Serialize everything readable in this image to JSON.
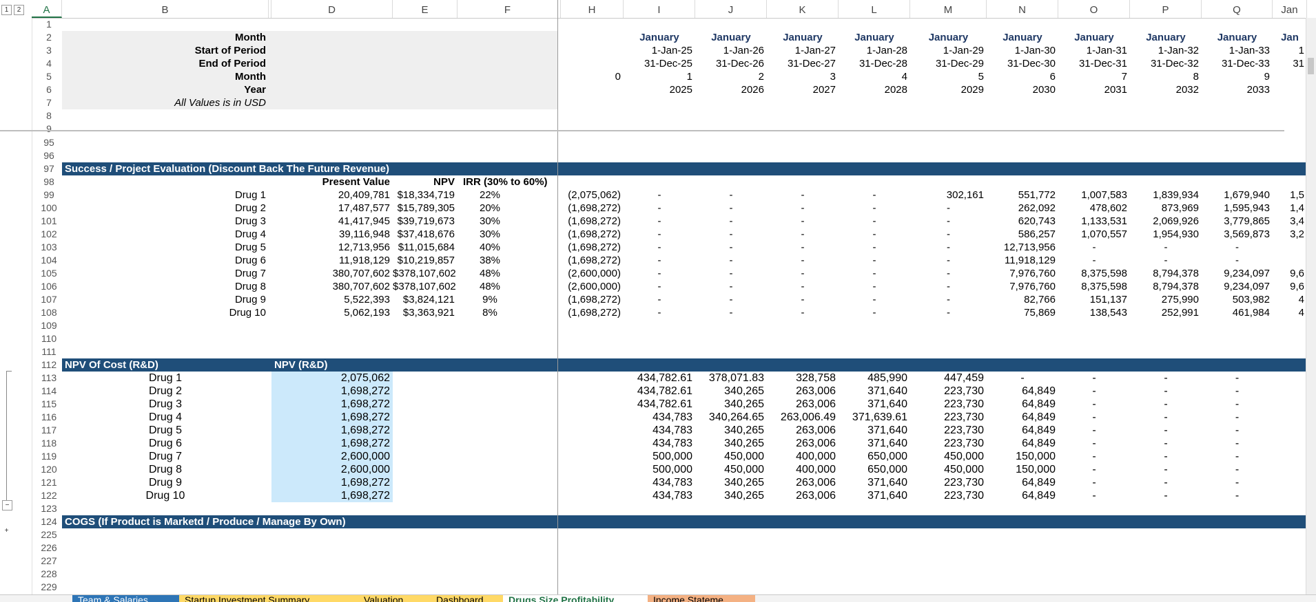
{
  "outline_levels": [
    "1",
    "2"
  ],
  "outline_collapse": "−",
  "outline_expand": "+",
  "columns": [
    "A",
    "B",
    "",
    "D",
    "E",
    "F",
    "",
    "H",
    "I",
    "J",
    "K",
    "L",
    "M",
    "N",
    "O",
    "P",
    "Q",
    "Jan"
  ],
  "header": {
    "labels": [
      "Month",
      "Start of Period",
      "End of Period",
      "Month",
      "Year"
    ],
    "note": "All Values is in USD",
    "h_month_index": "0",
    "months": [
      "January",
      "January",
      "January",
      "January",
      "January",
      "January",
      "January",
      "January",
      "January",
      "Jan"
    ],
    "starts": [
      "1-Jan-25",
      "1-Jan-26",
      "1-Jan-27",
      "1-Jan-28",
      "1-Jan-29",
      "1-Jan-30",
      "1-Jan-31",
      "1-Jan-32",
      "1-Jan-33",
      "1"
    ],
    "ends": [
      "31-Dec-25",
      "31-Dec-26",
      "31-Dec-27",
      "31-Dec-28",
      "31-Dec-29",
      "31-Dec-30",
      "31-Dec-31",
      "31-Dec-32",
      "31-Dec-33",
      "31"
    ],
    "month_nums": [
      "1",
      "2",
      "3",
      "4",
      "5",
      "6",
      "7",
      "8",
      "9"
    ],
    "years": [
      "2025",
      "2026",
      "2027",
      "2028",
      "2029",
      "2030",
      "2031",
      "2032",
      "2033"
    ]
  },
  "row_numbers_top": [
    "1",
    "2",
    "3",
    "4",
    "5",
    "6",
    "7",
    "8",
    "9"
  ],
  "success": {
    "title": "Success / Project Evaluation (Discount Back The Future Revenue)",
    "headers": [
      "Present Value",
      "NPV",
      "IRR (30% to 60%)"
    ],
    "rows": [
      {
        "n": "99",
        "drug": "Drug 1",
        "pv": "20,409,781",
        "npv": "$18,334,719",
        "irr": "22%",
        "h": "(2,075,062)",
        "v": [
          "-",
          "-",
          "-",
          "-",
          "302,161",
          "551,772",
          "1,007,583",
          "1,839,934",
          "1,679,940",
          "1,5"
        ]
      },
      {
        "n": "100",
        "drug": "Drug 2",
        "pv": "17,487,577",
        "npv": "$15,789,305",
        "irr": "20%",
        "h": "(1,698,272)",
        "v": [
          "-",
          "-",
          "-",
          "-",
          "-",
          "262,092",
          "478,602",
          "873,969",
          "1,595,943",
          "1,4"
        ]
      },
      {
        "n": "101",
        "drug": "Drug 3",
        "pv": "41,417,945",
        "npv": "$39,719,673",
        "irr": "30%",
        "h": "(1,698,272)",
        "v": [
          "-",
          "-",
          "-",
          "-",
          "-",
          "620,743",
          "1,133,531",
          "2,069,926",
          "3,779,865",
          "3,4"
        ]
      },
      {
        "n": "102",
        "drug": "Drug 4",
        "pv": "39,116,948",
        "npv": "$37,418,676",
        "irr": "30%",
        "h": "(1,698,272)",
        "v": [
          "-",
          "-",
          "-",
          "-",
          "-",
          "586,257",
          "1,070,557",
          "1,954,930",
          "3,569,873",
          "3,2"
        ]
      },
      {
        "n": "103",
        "drug": "Drug 5",
        "pv": "12,713,956",
        "npv": "$11,015,684",
        "irr": "40%",
        "h": "(1,698,272)",
        "v": [
          "-",
          "-",
          "-",
          "-",
          "-",
          "12,713,956",
          "-",
          "-",
          "-",
          ""
        ]
      },
      {
        "n": "104",
        "drug": "Drug 6",
        "pv": "11,918,129",
        "npv": "$10,219,857",
        "irr": "38%",
        "h": "(1,698,272)",
        "v": [
          "-",
          "-",
          "-",
          "-",
          "-",
          "11,918,129",
          "-",
          "-",
          "-",
          ""
        ]
      },
      {
        "n": "105",
        "drug": "Drug 7",
        "pv": "380,707,602",
        "npv": "$378,107,602",
        "irr": "48%",
        "h": "(2,600,000)",
        "v": [
          "-",
          "-",
          "-",
          "-",
          "-",
          "7,976,760",
          "8,375,598",
          "8,794,378",
          "9,234,097",
          "9,6"
        ]
      },
      {
        "n": "106",
        "drug": "Drug 8",
        "pv": "380,707,602",
        "npv": "$378,107,602",
        "irr": "48%",
        "h": "(2,600,000)",
        "v": [
          "-",
          "-",
          "-",
          "-",
          "-",
          "7,976,760",
          "8,375,598",
          "8,794,378",
          "9,234,097",
          "9,6"
        ]
      },
      {
        "n": "107",
        "drug": "Drug 9",
        "pv": "5,522,393",
        "npv": "$3,824,121",
        "irr": "9%",
        "h": "(1,698,272)",
        "v": [
          "-",
          "-",
          "-",
          "-",
          "-",
          "82,766",
          "151,137",
          "275,990",
          "503,982",
          "4"
        ]
      },
      {
        "n": "108",
        "drug": "Drug 10",
        "pv": "5,062,193",
        "npv": "$3,363,921",
        "irr": "8%",
        "h": "(1,698,272)",
        "v": [
          "-",
          "-",
          "-",
          "-",
          "-",
          "75,869",
          "138,543",
          "252,991",
          "461,984",
          "4"
        ]
      }
    ]
  },
  "npv_cost": {
    "title": "NPV Of Cost (R&D)",
    "col_title": "NPV (R&D)",
    "rows": [
      {
        "n": "113",
        "drug": "Drug 1",
        "npv": "2,075,062",
        "v": [
          "434,782.61",
          "378,071.83",
          "328,758",
          "485,990",
          "447,459",
          "-",
          "-",
          "-",
          "-"
        ]
      },
      {
        "n": "114",
        "drug": "Drug 2",
        "npv": "1,698,272",
        "v": [
          "434,782.61",
          "340,265",
          "263,006",
          "371,640",
          "223,730",
          "64,849",
          "-",
          "-",
          "-"
        ]
      },
      {
        "n": "115",
        "drug": "Drug 3",
        "npv": "1,698,272",
        "v": [
          "434,782.61",
          "340,265",
          "263,006",
          "371,640",
          "223,730",
          "64,849",
          "-",
          "-",
          "-"
        ]
      },
      {
        "n": "116",
        "drug": "Drug 4",
        "npv": "1,698,272",
        "v": [
          "434,783",
          "340,264.65",
          "263,006.49",
          "371,639.61",
          "223,730",
          "64,849",
          "-",
          "-",
          "-"
        ]
      },
      {
        "n": "117",
        "drug": "Drug 5",
        "npv": "1,698,272",
        "v": [
          "434,783",
          "340,265",
          "263,006",
          "371,640",
          "223,730",
          "64,849",
          "-",
          "-",
          "-"
        ]
      },
      {
        "n": "118",
        "drug": "Drug 6",
        "npv": "1,698,272",
        "v": [
          "434,783",
          "340,265",
          "263,006",
          "371,640",
          "223,730",
          "64,849",
          "-",
          "-",
          "-"
        ]
      },
      {
        "n": "119",
        "drug": "Drug 7",
        "npv": "2,600,000",
        "v": [
          "500,000",
          "450,000",
          "400,000",
          "650,000",
          "450,000",
          "150,000",
          "-",
          "-",
          "-"
        ]
      },
      {
        "n": "120",
        "drug": "Drug 8",
        "npv": "2,600,000",
        "v": [
          "500,000",
          "450,000",
          "400,000",
          "650,000",
          "450,000",
          "150,000",
          "-",
          "-",
          "-"
        ]
      },
      {
        "n": "121",
        "drug": "Drug 9",
        "npv": "1,698,272",
        "v": [
          "434,783",
          "340,265",
          "263,006",
          "371,640",
          "223,730",
          "64,849",
          "-",
          "-",
          "-"
        ]
      },
      {
        "n": "122",
        "drug": "Drug 10",
        "npv": "1,698,272",
        "v": [
          "434,783",
          "340,265",
          "263,006",
          "371,640",
          "223,730",
          "64,849",
          "-",
          "-",
          "-"
        ]
      }
    ]
  },
  "cogs_title": "COGS (If Product is Marketd / Produce / Manage By Own)",
  "empty_rows": [
    "95",
    "96",
    "109",
    "110",
    "111",
    "123",
    "225",
    "226",
    "227",
    "228",
    "229"
  ],
  "row_labels": {
    "r97": "97",
    "r98": "98",
    "r112": "112",
    "r124": "124"
  },
  "sheet_tabs": [
    "Team & Salaries",
    "Startup Investment Summary",
    "Valuation",
    "Dashboard",
    "Drugs Size Profitability",
    "Income Stateme"
  ],
  "colors": {
    "band": "#1f4e79",
    "navy_text": "#1f3864",
    "input_fill": "#cce9fb",
    "active_tab": "#217346"
  }
}
